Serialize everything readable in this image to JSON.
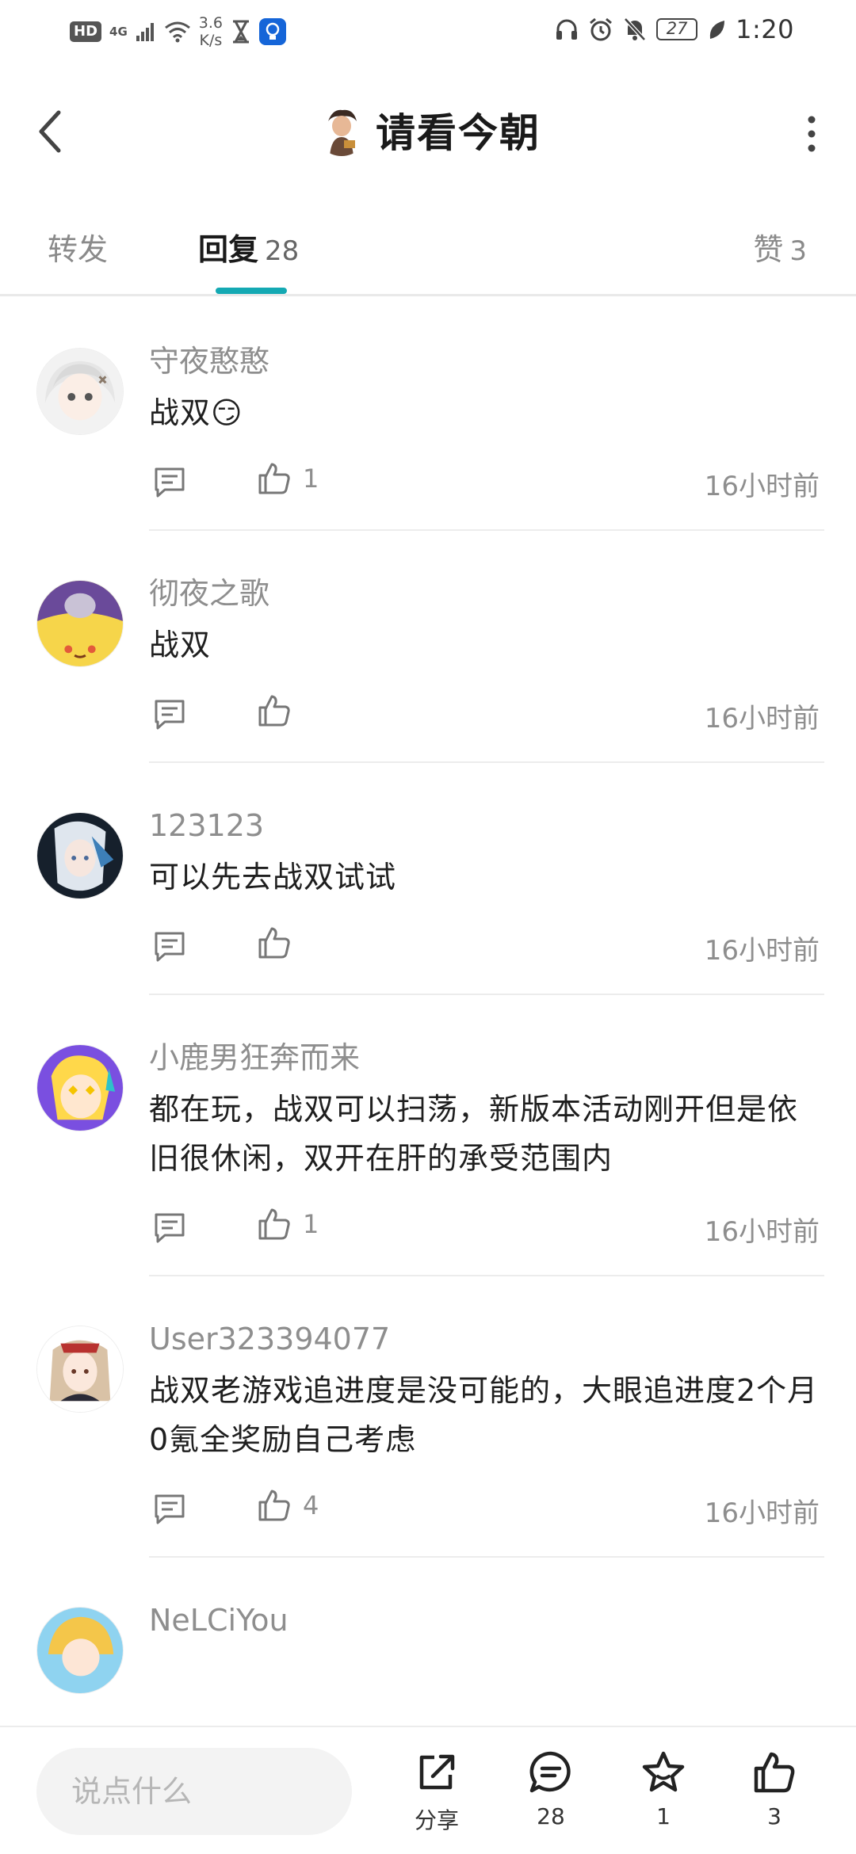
{
  "status_bar": {
    "hd": "HD",
    "network": "4G",
    "speed_value": "3.6",
    "speed_unit": "K/s",
    "battery": "27",
    "time": "1:20"
  },
  "header": {
    "title": "请看今朝"
  },
  "tabs": {
    "repost": "转发",
    "reply": "回复",
    "reply_count": "28",
    "like": "赞",
    "like_count": "3"
  },
  "comments": [
    {
      "name": "守夜憨憨",
      "text": "战双😏",
      "likes": "1",
      "time": "16小时前"
    },
    {
      "name": "彻夜之歌",
      "text": "战双",
      "likes": "",
      "time": "16小时前"
    },
    {
      "name": "123123",
      "text": "可以先去战双试试",
      "likes": "",
      "time": "16小时前"
    },
    {
      "name": "小鹿男狂奔而来",
      "text": "都在玩，战双可以扫荡，新版本活动刚开但是依旧很休闲，双开在肝的承受范围内",
      "likes": "1",
      "time": "16小时前"
    },
    {
      "name": "User323394077",
      "text": "战双老游戏追进度是没可能的，大眼追进度2个月0氪全奖励自己考虑",
      "likes": "4",
      "time": "16小时前"
    },
    {
      "name": "NeLCiYou",
      "text": "",
      "likes": "",
      "time": ""
    }
  ],
  "bottom_bar": {
    "input_placeholder": "说点什么",
    "share_label": "分享",
    "comments_count": "28",
    "favorites_count": "1",
    "likes_count": "3"
  },
  "colors": {
    "accent": "#14a9b3",
    "text_primary": "#1f1f1f",
    "text_secondary": "#8e8e8e"
  }
}
